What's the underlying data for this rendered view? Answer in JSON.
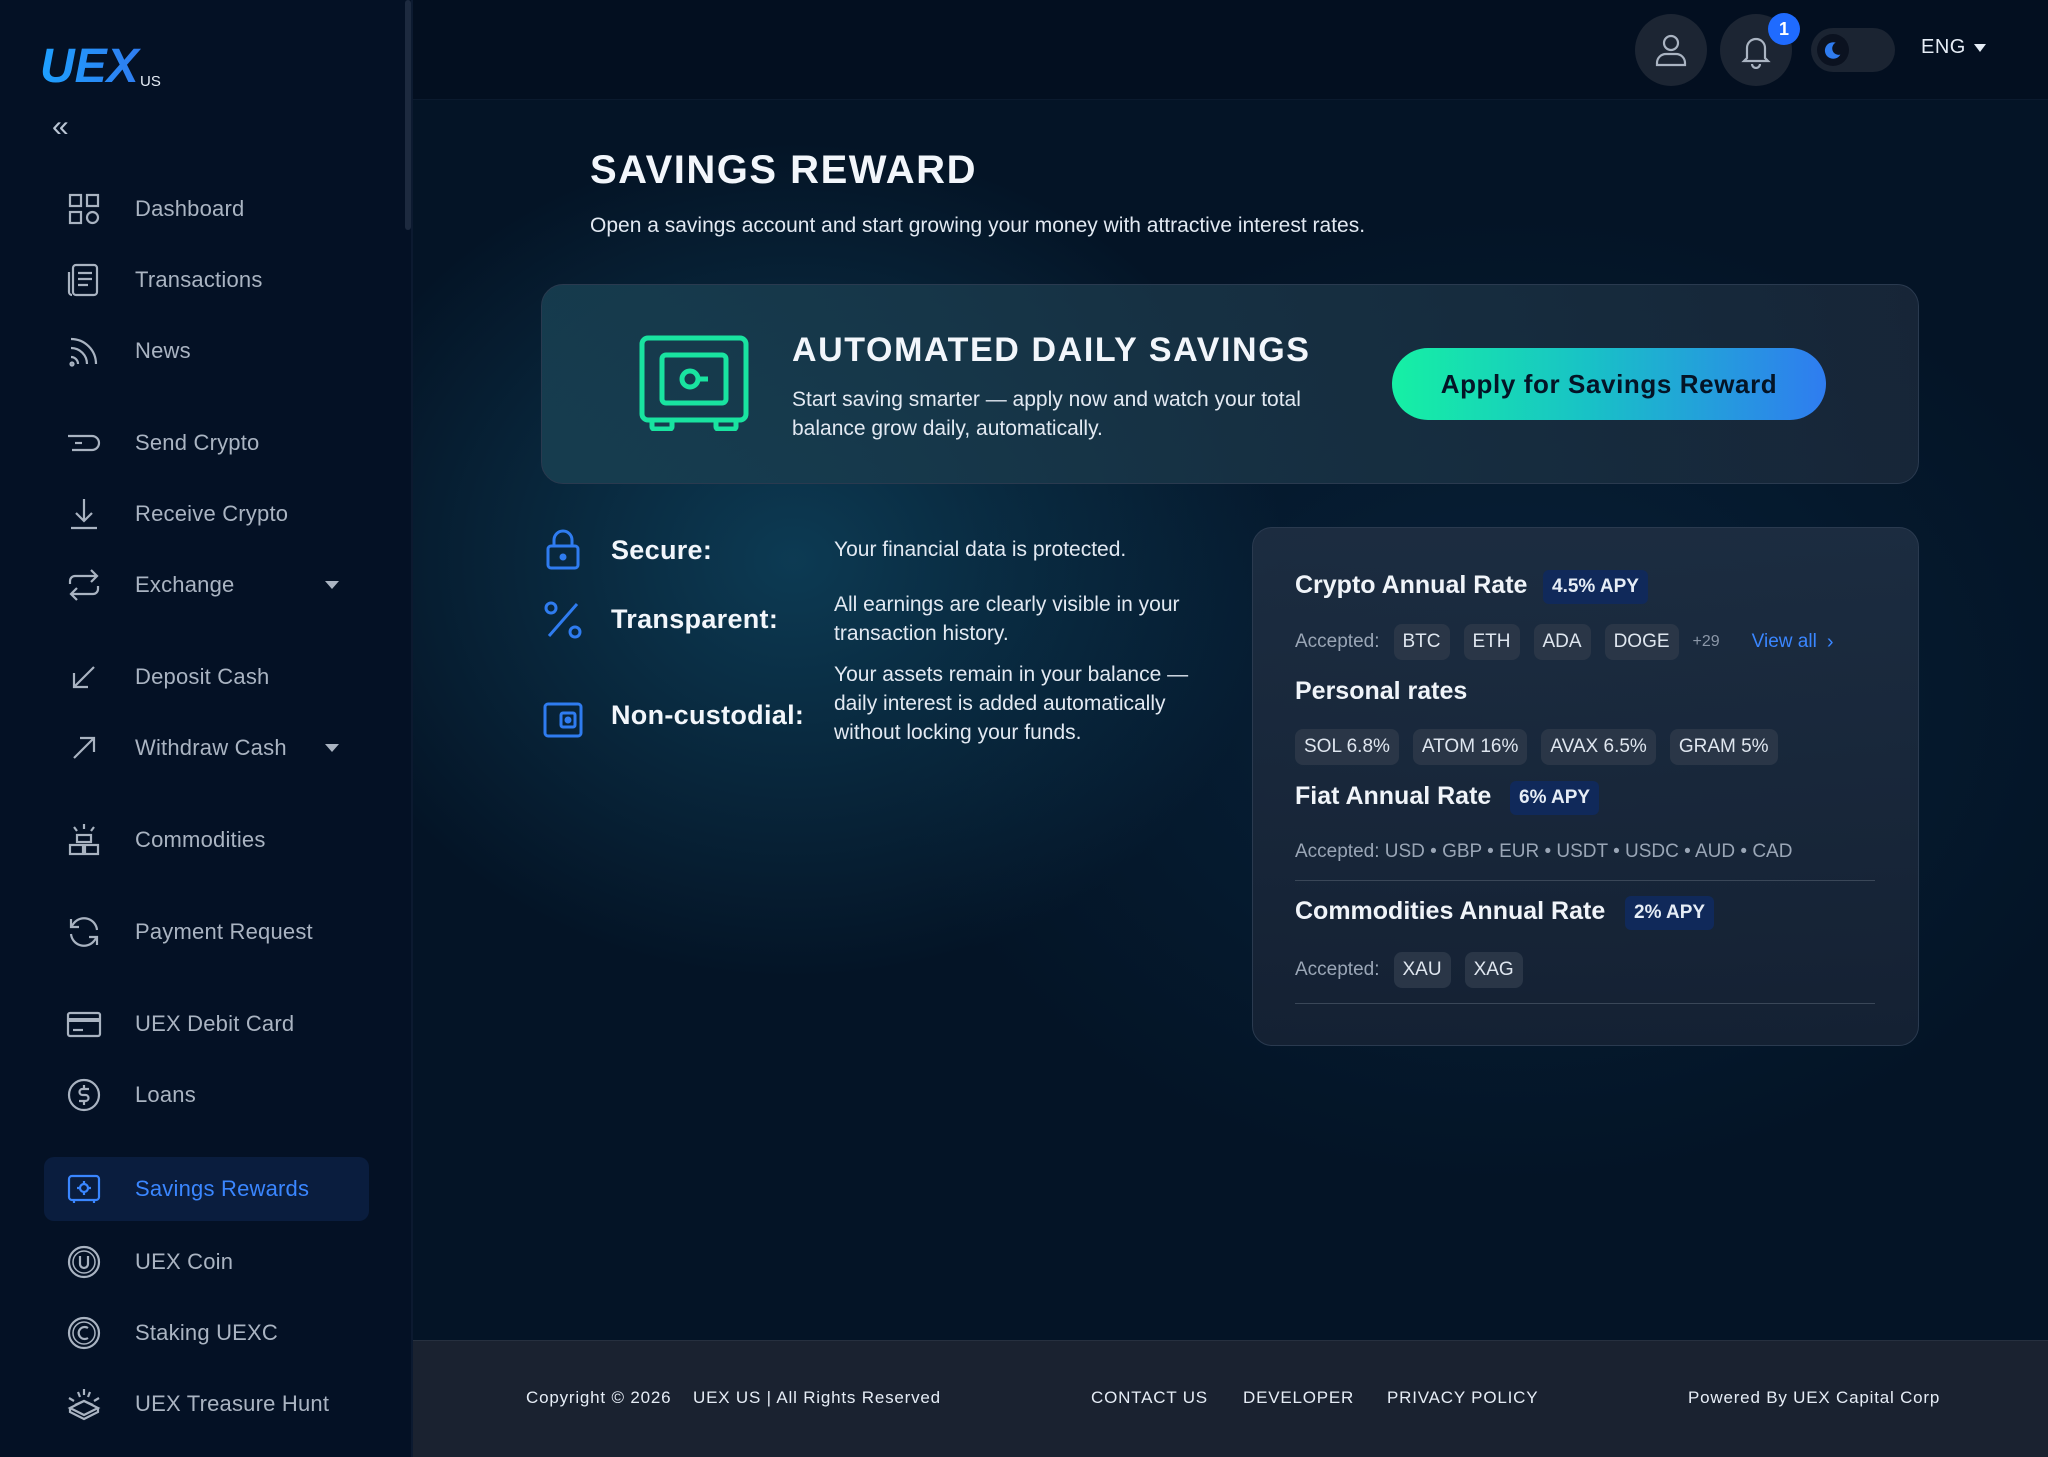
{
  "brand": {
    "logo_text": "UEX",
    "logo_sub": "US"
  },
  "sidebar": {
    "items": [
      {
        "label": "Dashboard",
        "icon": "grid-icon"
      },
      {
        "label": "Transactions",
        "icon": "document-icon"
      },
      {
        "label": "News",
        "icon": "rss-icon"
      },
      {
        "label": "Send Crypto",
        "icon": "send-icon"
      },
      {
        "label": "Receive Crypto",
        "icon": "download-icon"
      },
      {
        "label": "Exchange",
        "icon": "exchange-icon"
      },
      {
        "label": "Deposit Cash",
        "icon": "arrow-down-left-icon"
      },
      {
        "label": "Withdraw Cash",
        "icon": "arrow-up-right-icon"
      },
      {
        "label": "Commodities",
        "icon": "commodities-icon"
      },
      {
        "label": "Payment Request",
        "icon": "refresh-icon"
      },
      {
        "label": "UEX Debit Card",
        "icon": "card-icon"
      },
      {
        "label": "Loans",
        "icon": "dollar-icon"
      },
      {
        "label": "Savings Rewards",
        "icon": "safe-icon"
      },
      {
        "label": "UEX Coin",
        "icon": "coin-icon"
      },
      {
        "label": "Staking UEXC",
        "icon": "copyright-coin-icon"
      },
      {
        "label": "UEX Treasure Hunt",
        "icon": "treasure-icon"
      }
    ]
  },
  "header": {
    "notification_count": "1",
    "language": "ENG"
  },
  "page": {
    "title": "SAVINGS REWARD",
    "subtitle": "Open a savings account and start growing your money with attractive interest rates."
  },
  "banner": {
    "title": "AUTOMATED DAILY SAVINGS",
    "text": "Start saving smarter — apply now and watch your total balance grow daily, automatically.",
    "button": "Apply for Savings Reward"
  },
  "features": [
    {
      "name": "Secure:",
      "desc": "Your financial data is protected.",
      "icon": "lock-icon"
    },
    {
      "name": "Transparent:",
      "desc": "All earnings are clearly visible in your transaction history.",
      "icon": "percent-icon"
    },
    {
      "name": "Non-custodial:",
      "desc": "Your assets remain in your balance — daily interest is added automatically without locking your funds.",
      "icon": "wallet-icon"
    }
  ],
  "rates": {
    "crypto": {
      "title": "Crypto Annual Rate",
      "apy": "4.5% APY",
      "accepted_label": "Accepted:",
      "chips": [
        "BTC",
        "ETH",
        "ADA",
        "DOGE"
      ],
      "more": "+29",
      "view_all": "View all"
    },
    "personal": {
      "title": "Personal rates",
      "chips": [
        "SOL 6.8%",
        "ATOM 16%",
        "AVAX 6.5%",
        "GRAM 5%"
      ]
    },
    "fiat": {
      "title": "Fiat Annual Rate",
      "apy": "6% APY",
      "accepted": "Accepted: USD • GBP • EUR • USDT • USDC • AUD • CAD"
    },
    "commodities": {
      "title": "Commodities Annual Rate",
      "apy": "2% APY",
      "accepted_label": "Accepted:",
      "chips": [
        "XAU",
        "XAG"
      ]
    }
  },
  "footer": {
    "copyright": "Copyright © 2026",
    "rights": "UEX US | All Rights Reserved",
    "contact": "CONTACT US",
    "developer": "DEVELOPER",
    "privacy": "PRIVACY POLICY",
    "powered": "Powered By UEX Capital Corp"
  },
  "colors": {
    "accent": "#2f7cf0",
    "active_nav": "#3a86ff",
    "button_gradient_start": "#16f0a4",
    "button_gradient_end": "#2f7cf0",
    "safe_icon": "#19e3a0"
  }
}
